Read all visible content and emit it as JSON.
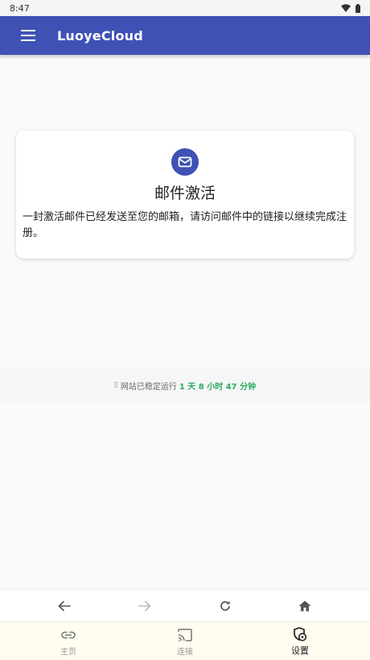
{
  "status_bar": {
    "time": "8:47"
  },
  "app_bar": {
    "title": "LuoyeCloud",
    "menu_icon": "menu-icon"
  },
  "card": {
    "icon": "mail-icon",
    "title": "邮件激活",
    "message": "一封激活邮件已经发送至您的邮箱，请访问邮件中的链接以继续完成注册。"
  },
  "uptime": {
    "prefix": "网站已稳定运行",
    "value": "1 天 8 小时 47 分钟"
  },
  "browser_nav": {
    "buttons": [
      "back-icon",
      "forward-icon",
      "reload-icon",
      "home-icon"
    ]
  },
  "tabs": [
    {
      "label": "主页",
      "icon": "link-icon",
      "active": false
    },
    {
      "label": "连接",
      "icon": "cast-icon",
      "active": false
    },
    {
      "label": "设置",
      "icon": "settings-shield-icon",
      "active": true
    }
  ],
  "colors": {
    "primary": "#3f51b5",
    "uptime_green": "#2eab5d",
    "tab_bar_bg": "#fffdf0"
  }
}
